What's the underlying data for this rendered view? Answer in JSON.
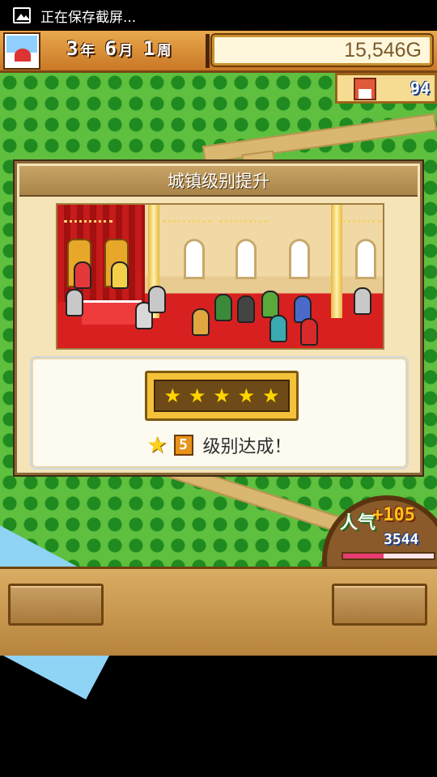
{
  "status_bar": {
    "notification": "正在保存截屏..."
  },
  "hud": {
    "year": "3",
    "year_unit": "年",
    "month": "6",
    "month_unit": "月",
    "week": "1",
    "week_unit": "周",
    "gold": "15,546G",
    "residents": "94"
  },
  "dialog": {
    "title": "城镇级别提升",
    "star_rating": 5,
    "level": "5",
    "achieved_text": "级别达成！"
  },
  "popularity": {
    "label": "人气",
    "increase": "+105",
    "total": "3544",
    "progress": 0.45
  },
  "colors": {
    "hud_gold_text": "#7a5a2c",
    "star": "#ffd600",
    "popularity_bar": "#ea3b73"
  }
}
